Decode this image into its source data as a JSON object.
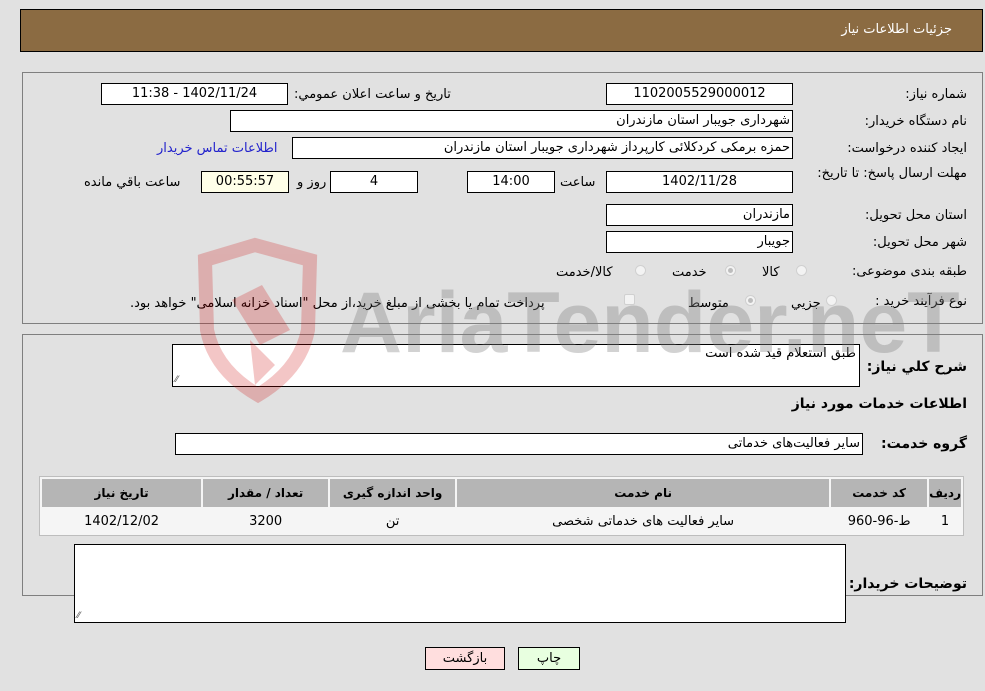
{
  "header": {
    "title": "جزئیات اطلاعات نیاز"
  },
  "fields": {
    "need_number": {
      "label": "شماره نیاز:",
      "value": "1102005529000012"
    },
    "announce_datetime": {
      "label": "تاریخ و ساعت اعلان عمومي:",
      "value": "1402/11/24 - 11:38"
    },
    "buyer_org": {
      "label": "نام دستگاه خریدار:",
      "value": "شهرداری جویبار استان مازندران"
    },
    "requester": {
      "label": "ایجاد کننده درخواست:",
      "value": "حمزه برمکی کردکلائی کارپرداز شهرداری جویبار استان مازندران"
    },
    "buyer_contact_link": "اطلاعات تماس خریدار",
    "deadline": {
      "label": "مهلت ارسال پاسخ: تا تاریخ:",
      "date": "1402/11/28",
      "time_label": "ساعت",
      "time": "14:00",
      "days": "4",
      "days_label": "روز و",
      "remaining": "00:55:57",
      "remaining_label": "ساعت باقي مانده"
    },
    "delivery_province": {
      "label": "استان محل تحویل:",
      "value": "مازندران"
    },
    "delivery_city": {
      "label": "شهر محل تحویل:",
      "value": "جویبار"
    },
    "category": {
      "label": "طبقه بندی موضوعی:",
      "options": [
        "کالا",
        "خدمت",
        "کالا/خدمت"
      ],
      "selected": "خدمت"
    },
    "purchase_type": {
      "label": "نوع فرآیند خرید :",
      "options": [
        "جزيي",
        "متوسط"
      ],
      "selected": "متوسط",
      "treasury_note": "پرداخت تمام یا بخشی از مبلغ خرید،از محل \"اسناد خزانه اسلامی\" خواهد بود."
    }
  },
  "description": {
    "label": "شرح کلي نیاز:",
    "value": "طبق   استعلام  قید شده است"
  },
  "services_section_title": "اطلاعات خدمات مورد نیاز",
  "service_group": {
    "label": "گروه خدمت:",
    "value": "سایر فعالیت‌های خدماتی"
  },
  "table": {
    "headers": [
      "ردیف",
      "کد خدمت",
      "نام خدمت",
      "واحد اندازه گیری",
      "تعداد / مقدار",
      "تاریخ نیاز"
    ],
    "rows": [
      [
        "1",
        "ط-96-960",
        "سایر فعالیت های خدماتی شخصی",
        "تن",
        "3200",
        "1402/12/02"
      ]
    ]
  },
  "buyer_notes": {
    "label": "توضیحات خریدار:",
    "value": ""
  },
  "buttons": {
    "print": "چاپ",
    "back": "بازگشت"
  },
  "watermark": {
    "text": "AriaTender.neT"
  }
}
